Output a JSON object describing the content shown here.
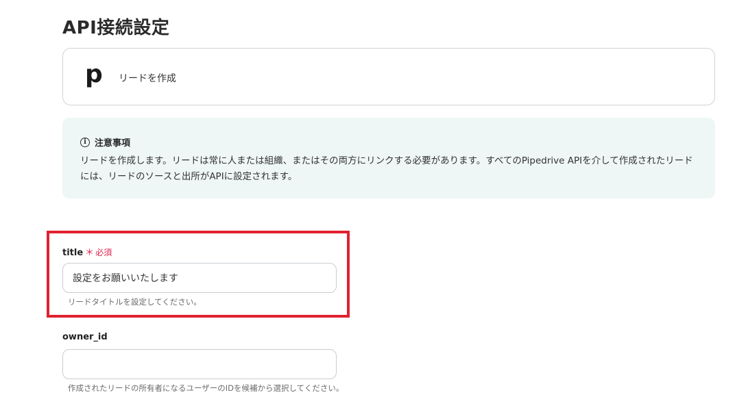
{
  "header": {
    "title": "API接続設定"
  },
  "app_card": {
    "logo_letter": "p",
    "action": "リードを作成"
  },
  "notice": {
    "title": "注意事項",
    "icon": "info-icon",
    "body": "リードを作成します。リードは常に人または組織、またはその両方にリンクする必要があります。すべてのPipedrive APIを介して作成されたリードには、リードのソースと出所がAPIに設定されます。"
  },
  "fields": {
    "title": {
      "label": "title",
      "required_mark": "＊",
      "required_text": "必須",
      "value": "設定をお願いいたします",
      "help": "リードタイトルを設定してください。"
    },
    "owner_id": {
      "label": "owner_id",
      "value": "",
      "help": "作成されたリードの所有者になるユーザーのIDを候補から選択してください。"
    }
  },
  "colors": {
    "highlight": "#e0212f",
    "required": "#e0214a",
    "notice_bg": "#eef7f5"
  }
}
